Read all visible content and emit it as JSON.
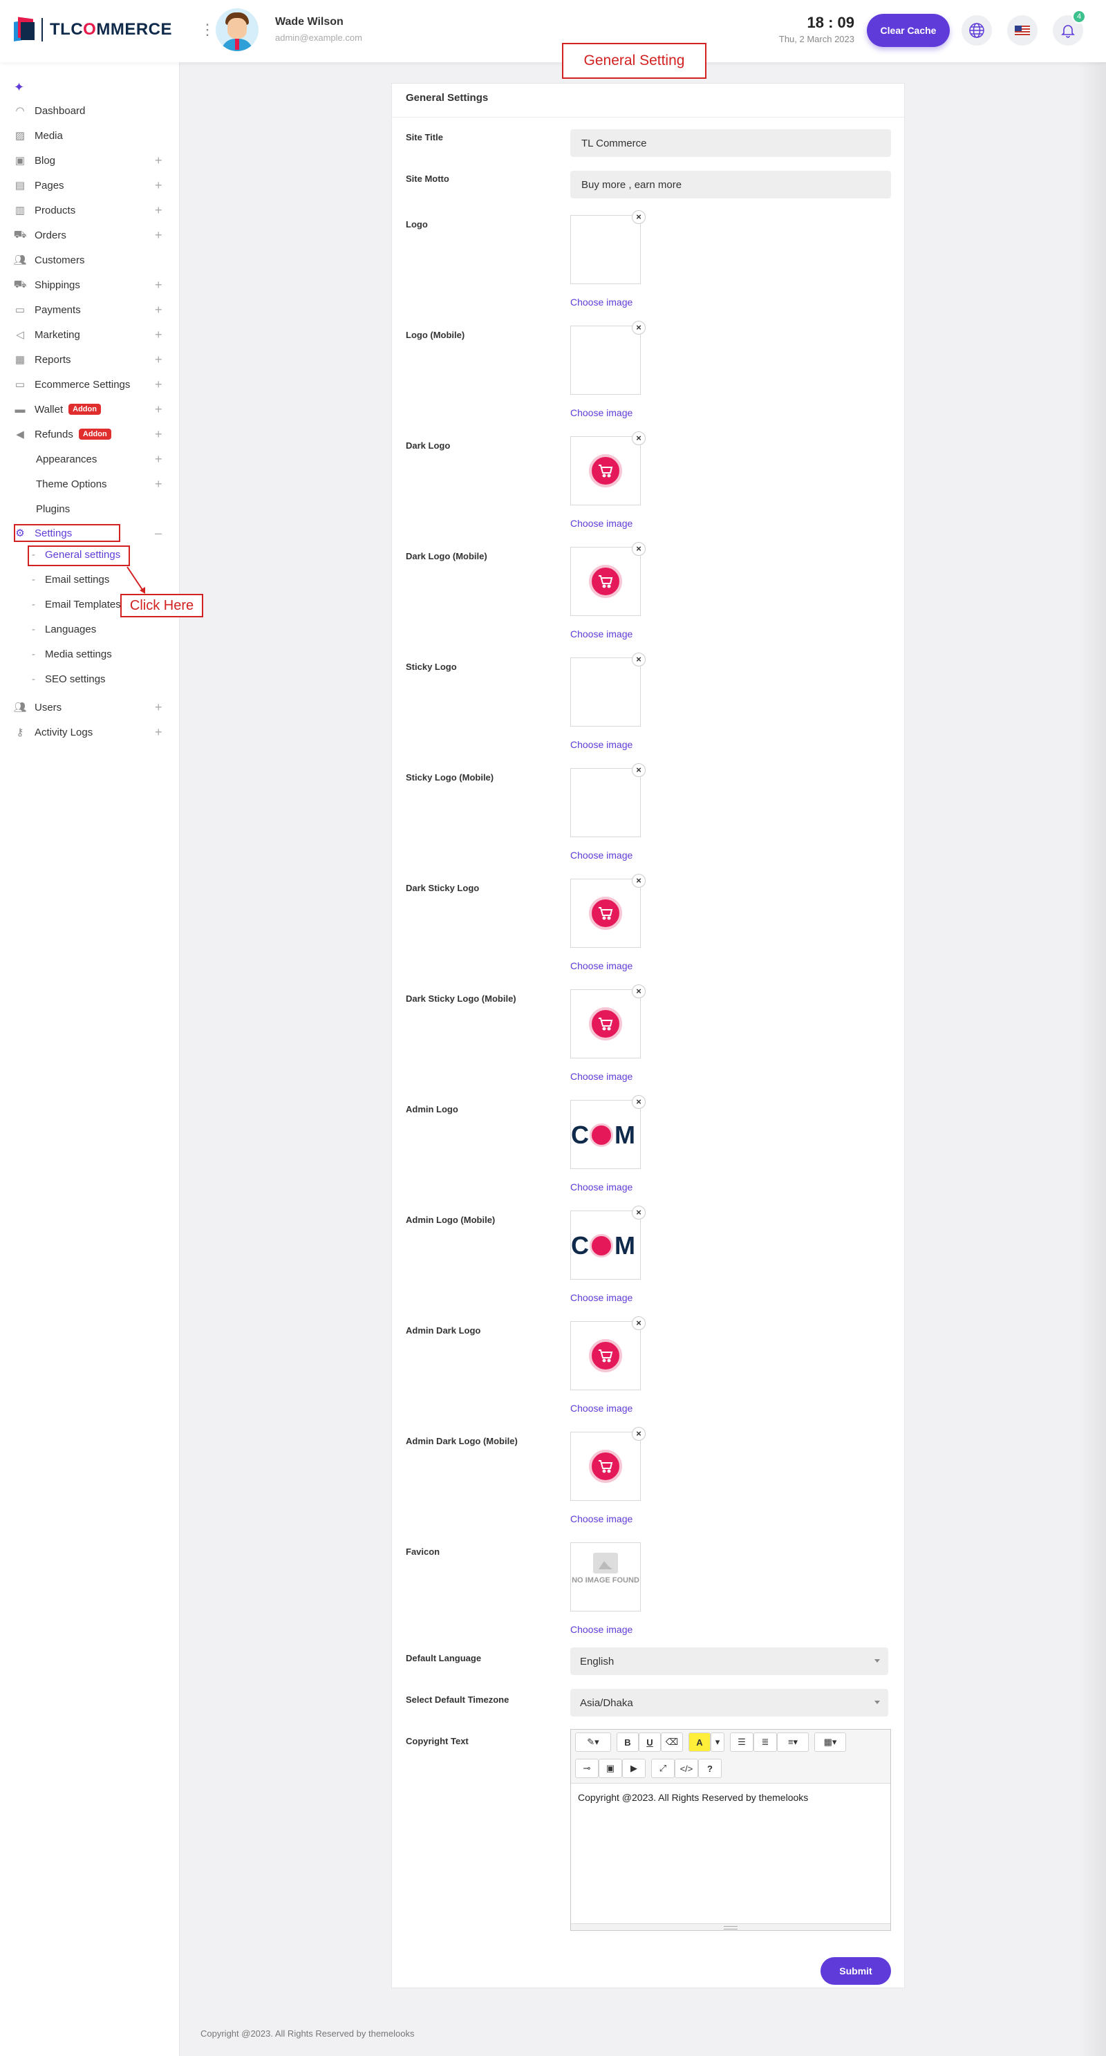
{
  "brand": {
    "name_pre": "TLC",
    "name_o": "O",
    "name_post": "MMERCE"
  },
  "user": {
    "name": "Wade Wilson",
    "email": "admin@example.com"
  },
  "header": {
    "time": "18 : 09",
    "date": "Thu, 2 March 2023",
    "clear_cache": "Clear Cache",
    "notifications": "4"
  },
  "annotations": {
    "top_callout": "General Setting",
    "click_here": "Click Here"
  },
  "sidebar": {
    "items": [
      {
        "label": "Dashboard",
        "icon": "gauge-icon"
      },
      {
        "label": "Media",
        "icon": "media-icon"
      },
      {
        "label": "Blog",
        "icon": "blog-icon"
      },
      {
        "label": "Pages",
        "icon": "pages-icon"
      },
      {
        "label": "Products",
        "icon": "products-icon"
      },
      {
        "label": "Orders",
        "icon": "cart-icon"
      },
      {
        "label": "Customers",
        "icon": "users-icon"
      },
      {
        "label": "Shippings",
        "icon": "truck-icon"
      },
      {
        "label": "Payments",
        "icon": "payment-icon"
      },
      {
        "label": "Marketing",
        "icon": "megaphone-icon"
      },
      {
        "label": "Reports",
        "icon": "report-icon"
      },
      {
        "label": "Ecommerce Settings",
        "icon": "window-icon"
      },
      {
        "label": "Wallet",
        "icon": "wallet-icon",
        "badge": "Addon"
      },
      {
        "label": "Refunds",
        "icon": "refund-icon",
        "badge": "Addon"
      },
      {
        "label": "Appearances"
      },
      {
        "label": "Theme Options"
      },
      {
        "label": "Plugins"
      },
      {
        "label": "Settings",
        "icon": "gears-icon"
      },
      {
        "label": "Users",
        "icon": "users-icon"
      },
      {
        "label": "Activity Logs",
        "icon": "key-icon"
      }
    ],
    "settings_sub": [
      "General settings",
      "Email settings",
      "Email Templates",
      "Languages",
      "Media settings",
      "SEO settings"
    ]
  },
  "form": {
    "title": "General Settings",
    "site_title_label": "Site Title",
    "site_title_value": "TL Commerce",
    "site_motto_label": "Site Motto",
    "site_motto_value": "Buy more , earn more",
    "choose_image": "Choose image",
    "remove_glyph": "×",
    "no_image": "NO IMAGE FOUND",
    "admin_logo_text": {
      "left": "C",
      "right": "M"
    },
    "image_fields": [
      {
        "label": "Logo",
        "preview": "empty"
      },
      {
        "label": "Logo (Mobile)",
        "preview": "empty"
      },
      {
        "label": "Dark Logo",
        "preview": "cart"
      },
      {
        "label": "Dark Logo (Mobile)",
        "preview": "cart"
      },
      {
        "label": "Sticky Logo",
        "preview": "empty"
      },
      {
        "label": "Sticky Logo (Mobile)",
        "preview": "empty"
      },
      {
        "label": "Dark Sticky Logo",
        "preview": "cart"
      },
      {
        "label": "Dark Sticky Logo (Mobile)",
        "preview": "cart"
      },
      {
        "label": "Admin Logo",
        "preview": "admin"
      },
      {
        "label": "Admin Logo (Mobile)",
        "preview": "admin"
      },
      {
        "label": "Admin Dark Logo",
        "preview": "cart"
      },
      {
        "label": "Admin Dark Logo (Mobile)",
        "preview": "cart"
      },
      {
        "label": "Favicon",
        "preview": "none"
      }
    ],
    "default_language_label": "Default Language",
    "default_language_value": "English",
    "timezone_label": "Select Default Timezone",
    "timezone_value": "Asia/Dhaka",
    "copyright_label": "Copyright Text",
    "copyright_value": "Copyright @2023. All Rights Reserved by themelooks",
    "submit": "Submit",
    "toolbar_icons": [
      "magic-icon",
      "bold-icon",
      "underline-icon",
      "eraser-icon",
      "font-color-icon",
      "ul-list-icon",
      "ol-list-icon",
      "align-icon",
      "table-icon",
      "link-icon",
      "image-icon",
      "video-icon",
      "fullscreen-icon",
      "code-icon",
      "help-icon"
    ]
  },
  "footer": "Copyright @2023. All Rights Reserved by themelooks",
  "colors": {
    "accent": "#5f3bd9",
    "brand_red": "#e6194b",
    "annotation_red": "#d32020",
    "badge_green": "#3cc08c"
  }
}
